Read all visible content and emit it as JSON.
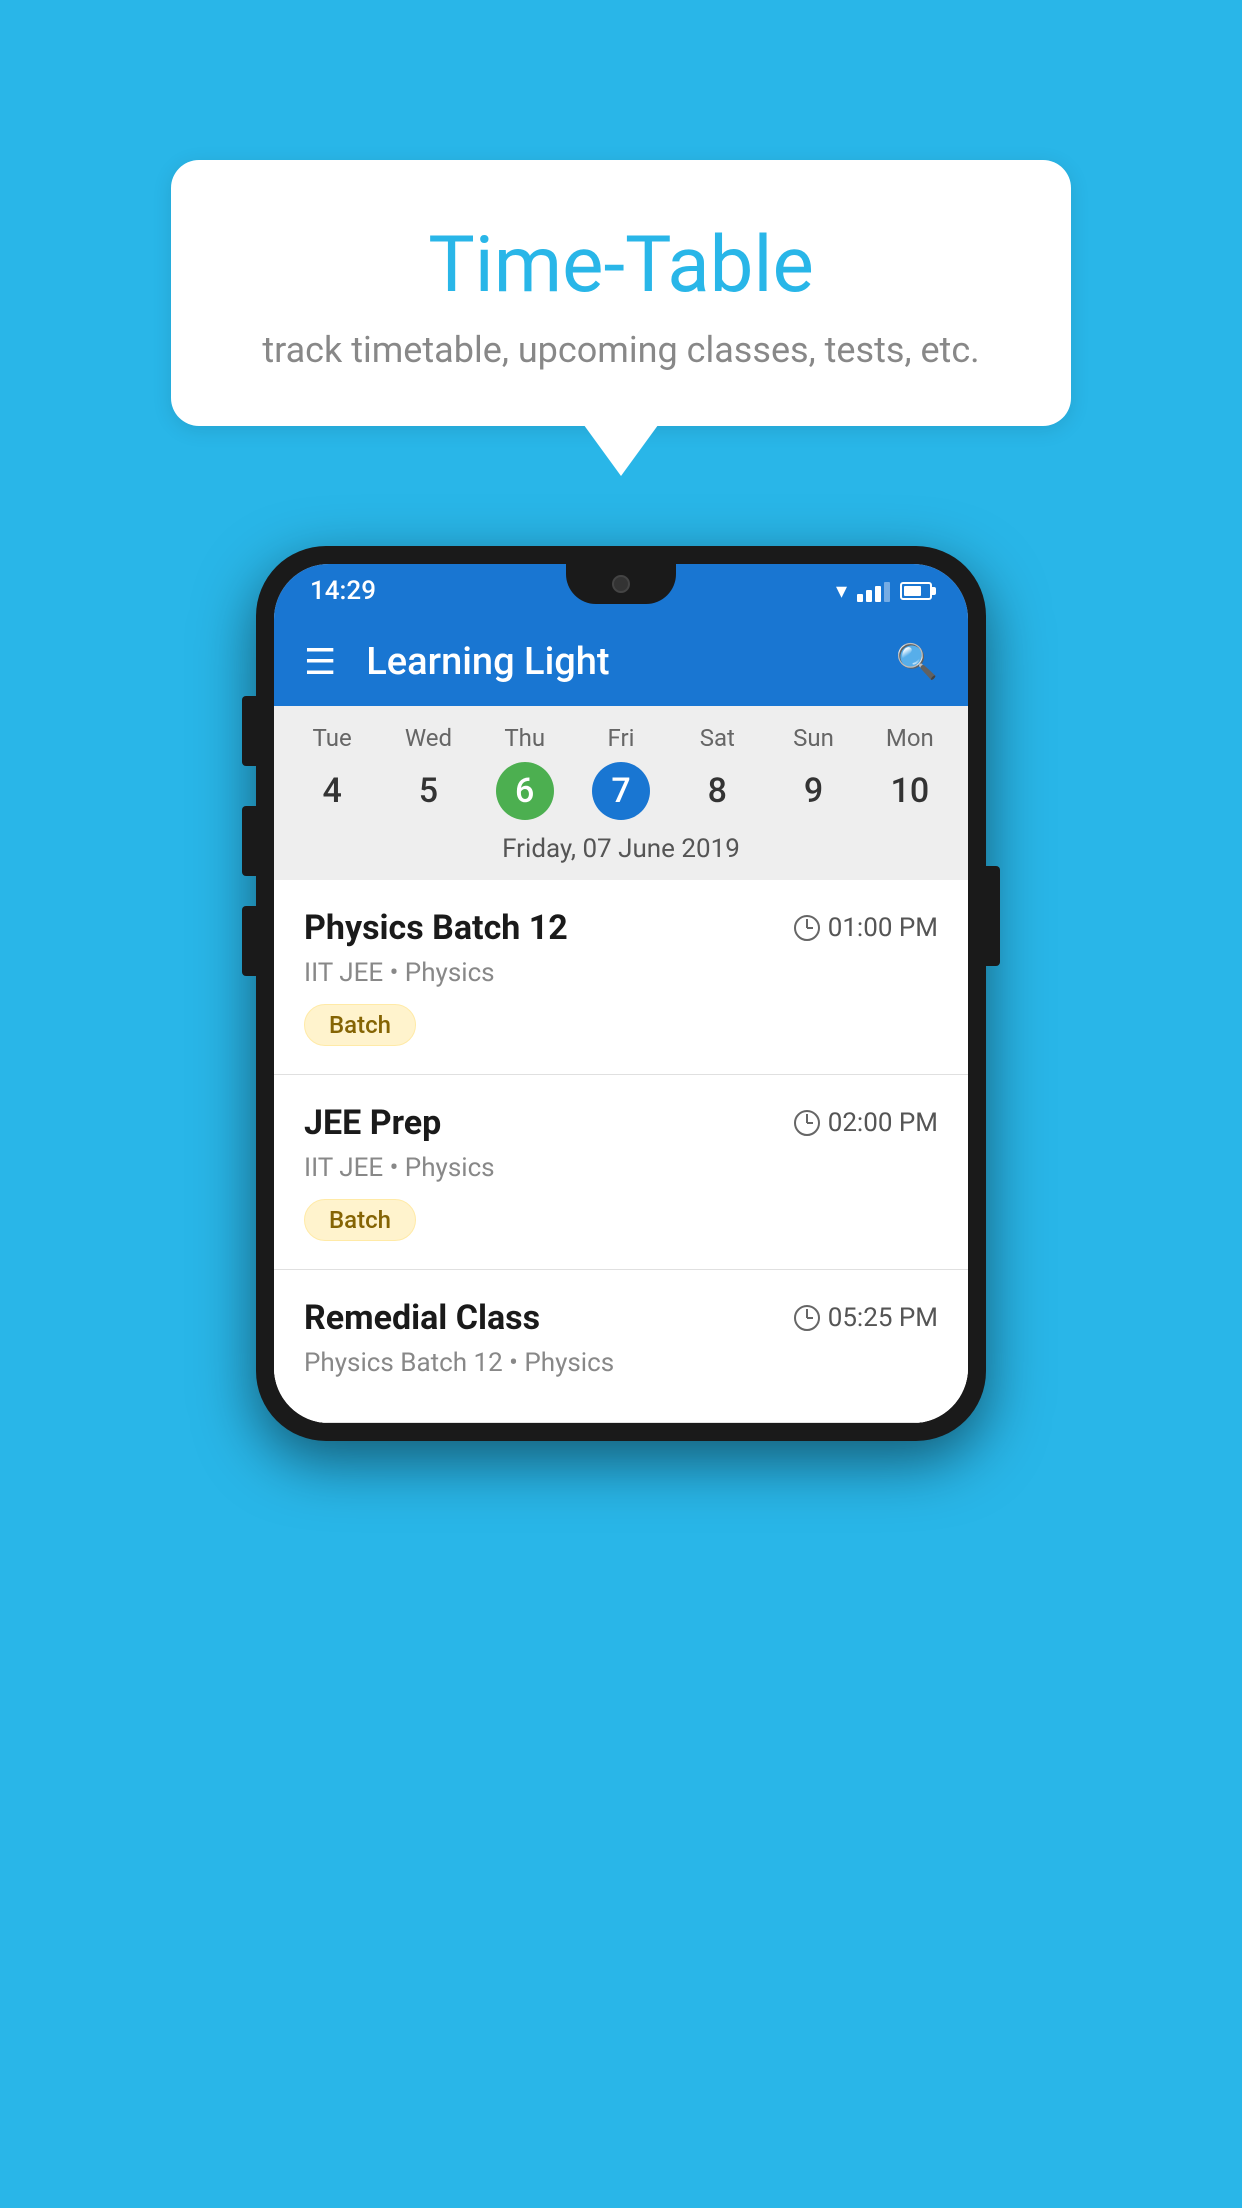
{
  "background_color": "#29B6E8",
  "bubble": {
    "title": "Time-Table",
    "subtitle": "track timetable, upcoming classes, tests, etc."
  },
  "phone": {
    "status_bar": {
      "time": "14:29",
      "signal": "signal",
      "wifi": "wifi",
      "battery": "battery"
    },
    "app_bar": {
      "title": "Learning Light",
      "hamburger_label": "menu",
      "search_label": "search"
    },
    "calendar": {
      "days": [
        {
          "name": "Tue",
          "number": "4",
          "state": "normal"
        },
        {
          "name": "Wed",
          "number": "5",
          "state": "normal"
        },
        {
          "name": "Thu",
          "number": "6",
          "state": "today"
        },
        {
          "name": "Fri",
          "number": "7",
          "state": "selected"
        },
        {
          "name": "Sat",
          "number": "8",
          "state": "normal"
        },
        {
          "name": "Sun",
          "number": "9",
          "state": "normal"
        },
        {
          "name": "Mon",
          "number": "10",
          "state": "normal"
        }
      ],
      "selected_date_label": "Friday, 07 June 2019"
    },
    "schedule": [
      {
        "title": "Physics Batch 12",
        "time": "01:00 PM",
        "subtitle": "IIT JEE • Physics",
        "tag": "Batch"
      },
      {
        "title": "JEE Prep",
        "time": "02:00 PM",
        "subtitle": "IIT JEE • Physics",
        "tag": "Batch"
      },
      {
        "title": "Remedial Class",
        "time": "05:25 PM",
        "subtitle": "Physics Batch 12 • Physics",
        "tag": null
      }
    ]
  }
}
